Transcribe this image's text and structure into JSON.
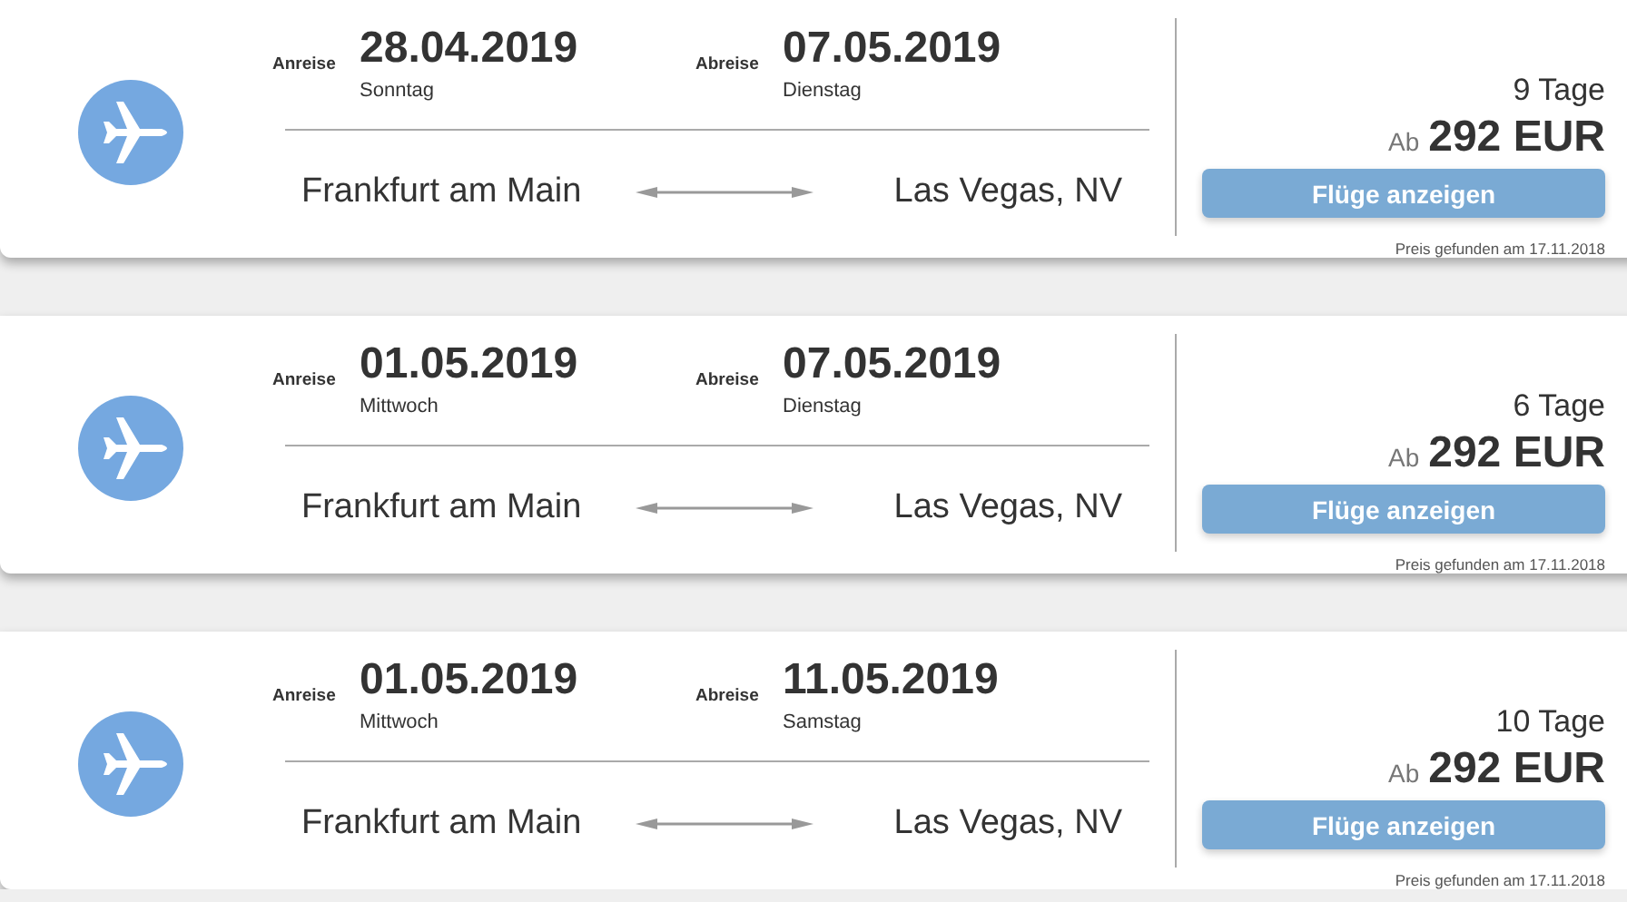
{
  "offers": [
    {
      "outbound": {
        "label": "Anreise",
        "date": "28.04.2019",
        "weekday": "Sonntag"
      },
      "return": {
        "label": "Abreise",
        "date": "07.05.2019",
        "weekday": "Dienstag"
      },
      "origin": "Frankfurt am Main",
      "destination": "Las Vegas, NV",
      "duration": "9 Tage",
      "price_prefix": "Ab",
      "price": "292 EUR",
      "button": "Flüge anzeigen",
      "found": "Preis gefunden am 17.11.2018"
    },
    {
      "outbound": {
        "label": "Anreise",
        "date": "01.05.2019",
        "weekday": "Mittwoch"
      },
      "return": {
        "label": "Abreise",
        "date": "07.05.2019",
        "weekday": "Dienstag"
      },
      "origin": "Frankfurt am Main",
      "destination": "Las Vegas, NV",
      "duration": "6 Tage",
      "price_prefix": "Ab",
      "price": "292 EUR",
      "button": "Flüge anzeigen",
      "found": "Preis gefunden am 17.11.2018"
    },
    {
      "outbound": {
        "label": "Anreise",
        "date": "01.05.2019",
        "weekday": "Mittwoch"
      },
      "return": {
        "label": "Abreise",
        "date": "11.05.2019",
        "weekday": "Samstag"
      },
      "origin": "Frankfurt am Main",
      "destination": "Las Vegas, NV",
      "duration": "10 Tage",
      "price_prefix": "Ab",
      "price": "292 EUR",
      "button": "Flüge anzeigen",
      "found": "Preis gefunden am 17.11.2018"
    }
  ]
}
